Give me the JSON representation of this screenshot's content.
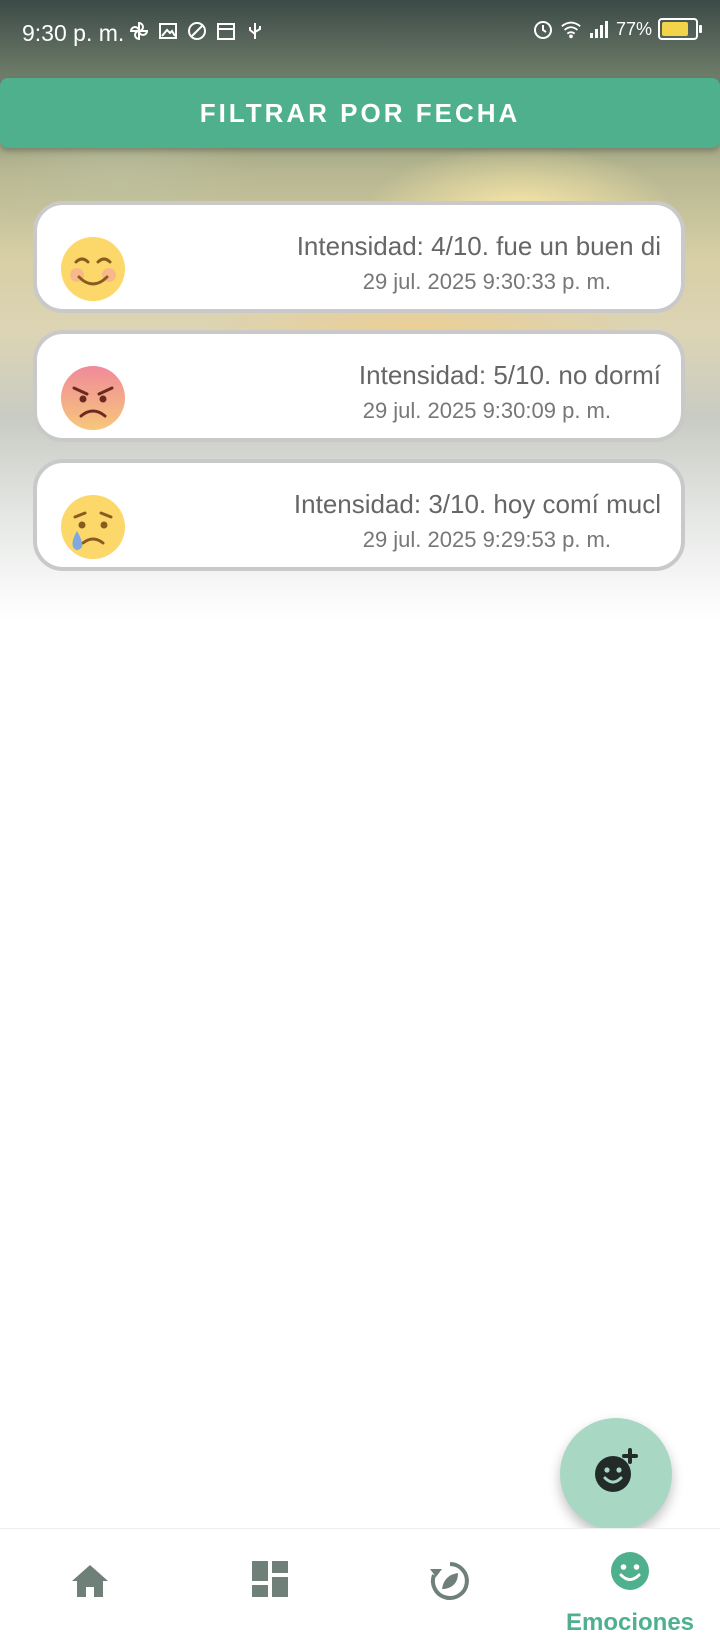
{
  "status_bar": {
    "time": "9:30 p. m.",
    "battery": "77%",
    "left_icons": [
      "pinwheel-icon",
      "image-icon",
      "at-sign-icon",
      "calendar-icon",
      "usb-icon"
    ],
    "right_icons": [
      "alarm-icon",
      "wifi-icon",
      "signal-icon",
      "battery-charging-icon"
    ]
  },
  "filter_button": {
    "label": "FILTRAR POR FECHA"
  },
  "entries": [
    {
      "emoji": "smiling-face-icon",
      "text": "Intensidad: 4/10. fue un buen di",
      "timestamp": "29 jul. 2025 9:30:33 p. m."
    },
    {
      "emoji": "angry-face-icon",
      "text": "Intensidad: 5/10. no dormí",
      "timestamp": "29 jul. 2025 9:30:09 p. m."
    },
    {
      "emoji": "crying-face-icon",
      "text": "Intensidad: 3/10. hoy comí mucl",
      "timestamp": "29 jul. 2025 9:29:53 p. m."
    }
  ],
  "fab": {
    "icon": "add-emotion-icon"
  },
  "bottom_nav": {
    "items": [
      {
        "icon": "home-icon",
        "label": ""
      },
      {
        "icon": "dashboard-icon",
        "label": ""
      },
      {
        "icon": "recycle-leaf-icon",
        "label": ""
      },
      {
        "icon": "emotion-face-icon",
        "label": "Emociones",
        "active": true
      }
    ]
  },
  "colors": {
    "accent": "#4fb08e",
    "fab": "#a8d8c4",
    "card_border": "#c9c9c9"
  }
}
